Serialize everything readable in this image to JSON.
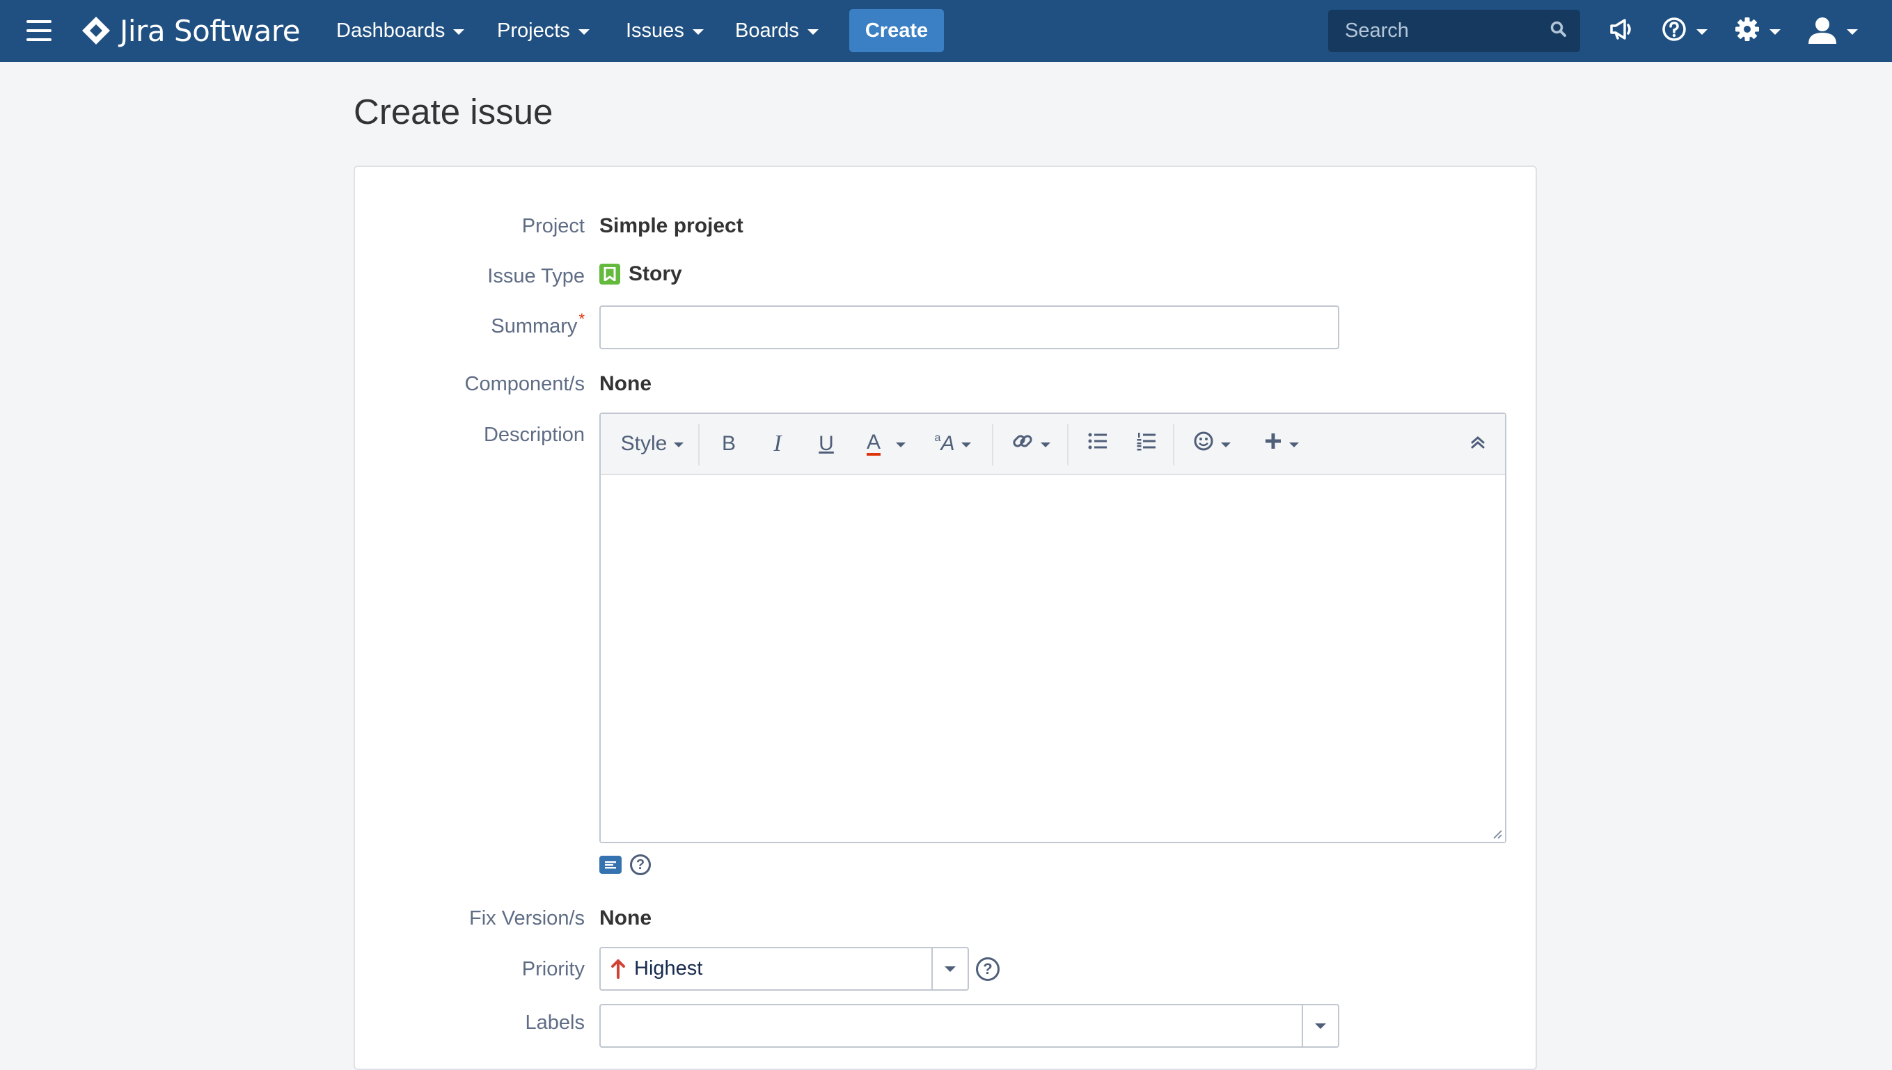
{
  "nav": {
    "app_name": "Jira Software",
    "menus": [
      {
        "label": "Dashboards"
      },
      {
        "label": "Projects"
      },
      {
        "label": "Issues"
      },
      {
        "label": "Boards"
      }
    ],
    "create_label": "Create",
    "search_placeholder": "Search",
    "icons": [
      "menu-icon",
      "jira-logo-icon",
      "search-icon",
      "megaphone-icon",
      "help-icon",
      "gear-icon",
      "user-avatar-icon"
    ],
    "bar_color": "#205081",
    "create_color": "#3b7fc4"
  },
  "page": {
    "title": "Create issue"
  },
  "form": {
    "project": {
      "label": "Project",
      "value": "Simple project"
    },
    "issue_type": {
      "label": "Issue Type",
      "value": "Story",
      "icon": "story-icon",
      "icon_color": "#63ba3c"
    },
    "summary": {
      "label": "Summary",
      "required_mark": "*",
      "value": ""
    },
    "components": {
      "label": "Component/s",
      "value": "None"
    },
    "description": {
      "label": "Description",
      "value": "",
      "toolbar": {
        "style_label": "Style",
        "bold_label": "B",
        "italic_label": "I",
        "underline_label": "U",
        "text_color_label": "A",
        "text_size_label": "A",
        "text_color_accent": "#de350b"
      }
    },
    "fix_versions": {
      "label": "Fix Version/s",
      "value": "None"
    },
    "priority": {
      "label": "Priority",
      "value": "Highest",
      "arrow_color": "#d04437"
    },
    "labels": {
      "label": "Labels"
    }
  }
}
